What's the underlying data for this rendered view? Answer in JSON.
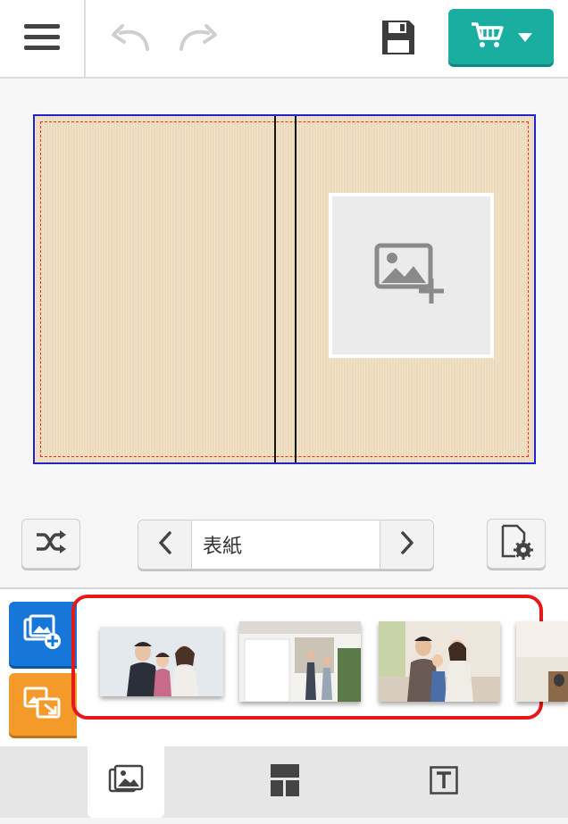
{
  "toolbar": {
    "menu_icon": "hamburger-icon",
    "undo_icon": "undo-icon",
    "redo_icon": "redo-icon",
    "save_icon": "floppy-disk-icon",
    "cart_icon": "cart-icon",
    "cart_dropdown_icon": "caret-down-icon",
    "accent_color": "#1aaea0"
  },
  "editor": {
    "photo_slot_icon": "add-image-icon",
    "cover_color": "#f1dfc0",
    "trim_line_color": "#2222cc",
    "safe_line_color": "#e0332f"
  },
  "controls": {
    "shuffle_icon": "shuffle-icon",
    "prev_icon": "chevron-left-icon",
    "page_label": "表紙",
    "next_icon": "chevron-right-icon",
    "page_settings_icon": "page-settings-icon"
  },
  "tray": {
    "add_photo_icon": "add-photo-icon",
    "swap_photo_icon": "swap-photo-icon",
    "highlight_color": "#e61919",
    "thumbnails": [
      {
        "name": "photo-thumbnail-family-studio"
      },
      {
        "name": "photo-thumbnail-family-house"
      },
      {
        "name": "photo-thumbnail-family-sofa"
      },
      {
        "name": "photo-thumbnail-partial"
      }
    ]
  },
  "tabs": {
    "photos_icon": "photos-tab-icon",
    "layout_icon": "layout-tab-icon",
    "text_icon": "text-tab-icon",
    "active": "photos"
  }
}
